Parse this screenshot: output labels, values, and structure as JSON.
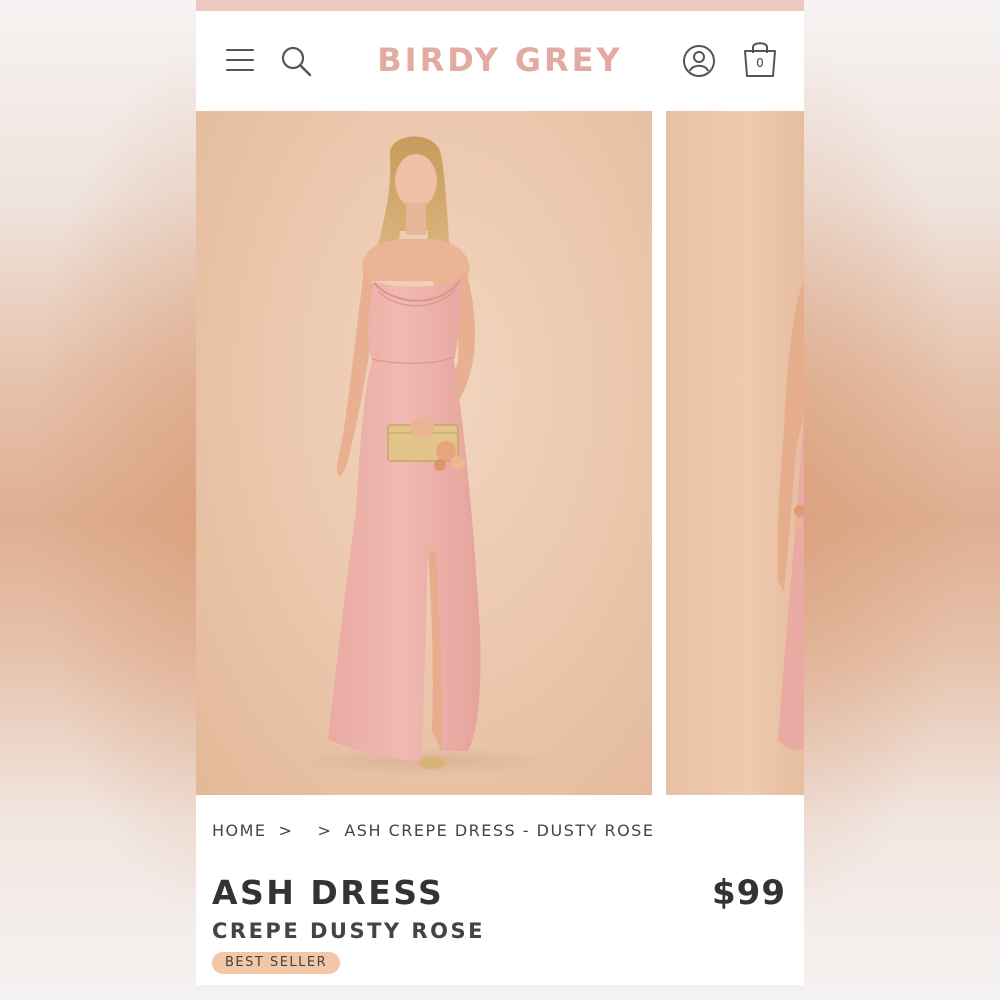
{
  "header": {
    "logo": "BIRDY GREY",
    "cart_count": "0"
  },
  "icons": {
    "menu": "hamburger-menu-icon",
    "search": "search-icon",
    "account": "account-icon",
    "bag": "shopping-bag-icon"
  },
  "gallery": {
    "images": [
      {
        "alt": "model wearing dusty rose crepe dress holding gold clutch"
      },
      {
        "alt": "next product image partially visible"
      }
    ]
  },
  "breadcrumb": {
    "items": [
      "HOME",
      "",
      "ASH CREPE DRESS - DUSTY ROSE"
    ],
    "separator": ">"
  },
  "product": {
    "title": "ASH DRESS",
    "subtitle": "CREPE DUSTY ROSE",
    "price": "$99",
    "badge": "BEST SELLER"
  },
  "colors": {
    "brand": "#e2aaa0",
    "promo_bar": "#ecc9c0",
    "badge_bg": "#f3c6a6",
    "text": "#333333"
  }
}
